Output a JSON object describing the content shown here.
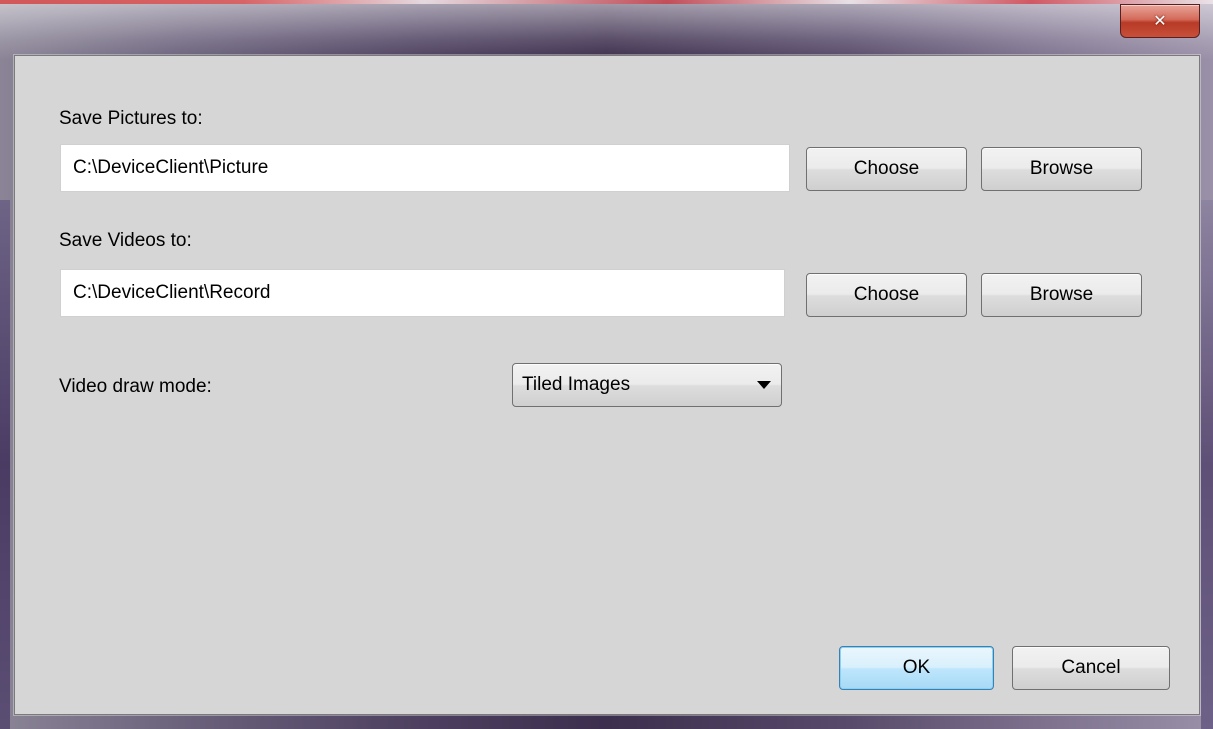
{
  "window": {
    "close_icon": "close-icon"
  },
  "pictures": {
    "label": "Save Pictures to:",
    "path": "C:\\DeviceClient\\Picture",
    "choose_label": "Choose",
    "browse_label": "Browse"
  },
  "videos": {
    "label": "Save Videos to:",
    "path": "C:\\DeviceClient\\Record",
    "choose_label": "Choose",
    "browse_label": "Browse"
  },
  "draw_mode": {
    "label": "Video draw mode:",
    "selected": "Tiled Images"
  },
  "footer": {
    "ok_label": "OK",
    "cancel_label": "Cancel"
  },
  "colors": {
    "client_background": "#d6d6d6",
    "default_button_border": "#3c7fb1",
    "close_button": "#c8503a"
  }
}
